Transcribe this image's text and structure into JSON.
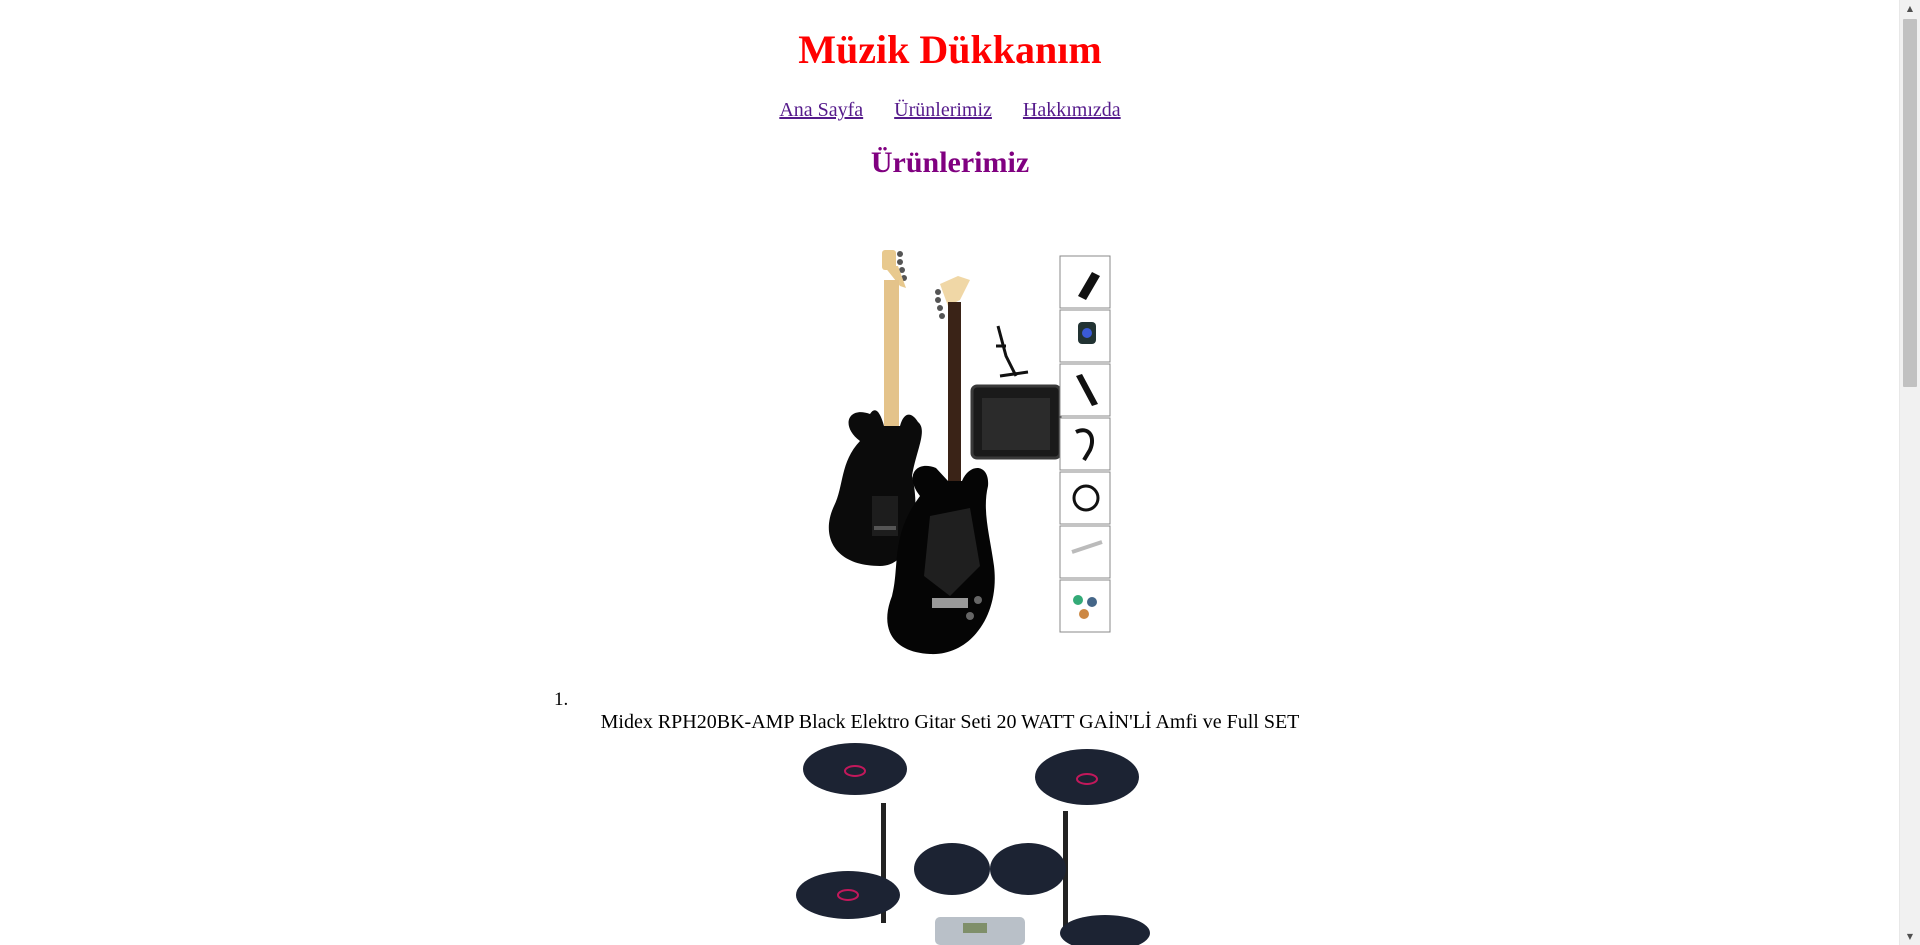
{
  "site": {
    "title": "Müzik Dükkanım"
  },
  "nav": {
    "home": "Ana Sayfa",
    "products": "Ürünlerimiz",
    "about": "Hakkımızda"
  },
  "section": {
    "title": "Ürünlerimiz"
  },
  "products": [
    {
      "number": "1.",
      "name": "Midex RPH20BK-AMP Black Elektro Gitar Seti 20 WATT GAİN'Lİ Amfi ve Full SET"
    }
  ],
  "colors": {
    "title": "#ff0000",
    "section_title": "#800080",
    "link": "#551a8b"
  },
  "icons": {
    "scroll_up": "scroll-up-arrow-icon",
    "scroll_down": "scroll-down-arrow-icon"
  }
}
